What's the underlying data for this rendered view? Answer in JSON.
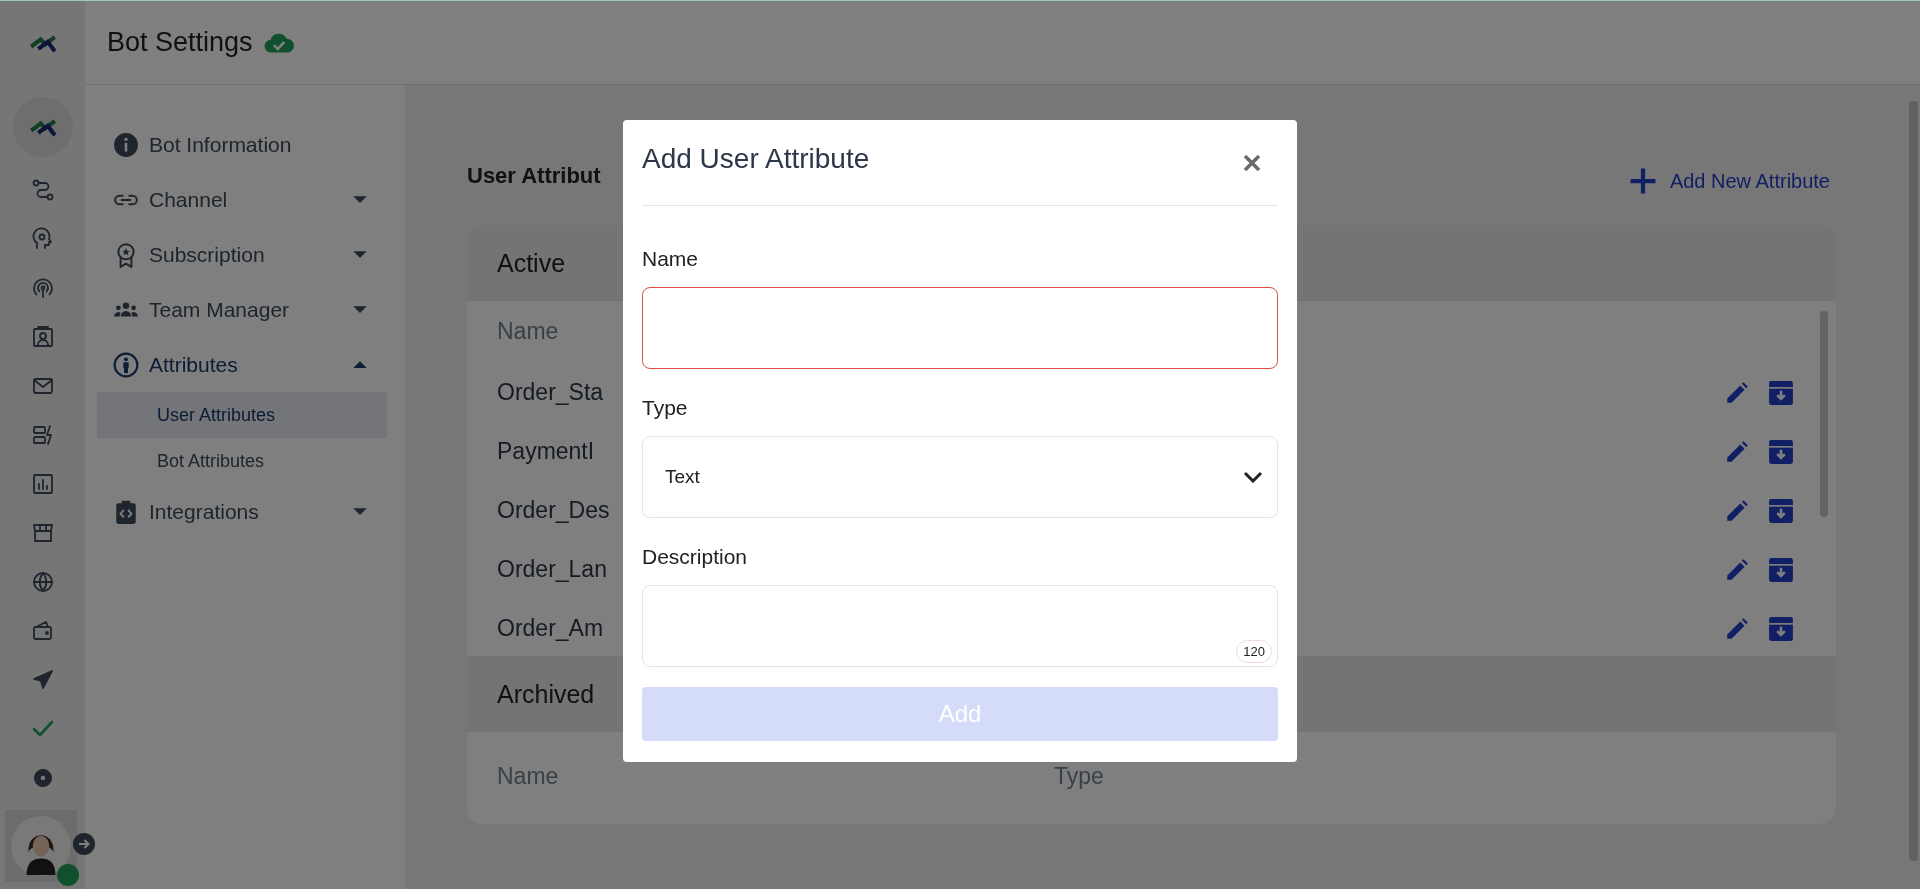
{
  "header": {
    "title": "Bot Settings",
    "saved": true
  },
  "user": {
    "online": true
  },
  "settings_nav": {
    "items": [
      {
        "label": "Bot Information",
        "kind": "link"
      },
      {
        "label": "Channel",
        "kind": "group",
        "expanded": false
      },
      {
        "label": "Subscription",
        "kind": "group",
        "expanded": false
      },
      {
        "label": "Team Manager",
        "kind": "group",
        "expanded": false
      },
      {
        "label": "Attributes",
        "kind": "group",
        "expanded": true,
        "children": [
          {
            "label": "User Attributes",
            "selected": true
          },
          {
            "label": "Bot Attributes",
            "selected": false
          }
        ]
      },
      {
        "label": "Integrations",
        "kind": "group",
        "expanded": false
      }
    ]
  },
  "main": {
    "heading": "User Attribut",
    "add_button": "Add New Attribute",
    "active": {
      "title": "Active",
      "columns": [
        "Name"
      ],
      "rows": [
        {
          "name": "Order_Sta"
        },
        {
          "name": "PaymentI"
        },
        {
          "name": "Order_Des"
        },
        {
          "name": "Order_Lan"
        },
        {
          "name": "Order_Am"
        }
      ]
    },
    "archived": {
      "title": "Archived",
      "columns": [
        "Name",
        "Type"
      ]
    }
  },
  "modal": {
    "title": "Add User Attribute",
    "fields": [
      {
        "kind": "text",
        "label": "Name",
        "invalid": true
      },
      {
        "kind": "select",
        "label": "Type",
        "value": "Text"
      },
      {
        "kind": "textarea",
        "label": "Description",
        "counter": "120"
      }
    ],
    "submit": {
      "label": "Add",
      "disabled": true
    }
  }
}
